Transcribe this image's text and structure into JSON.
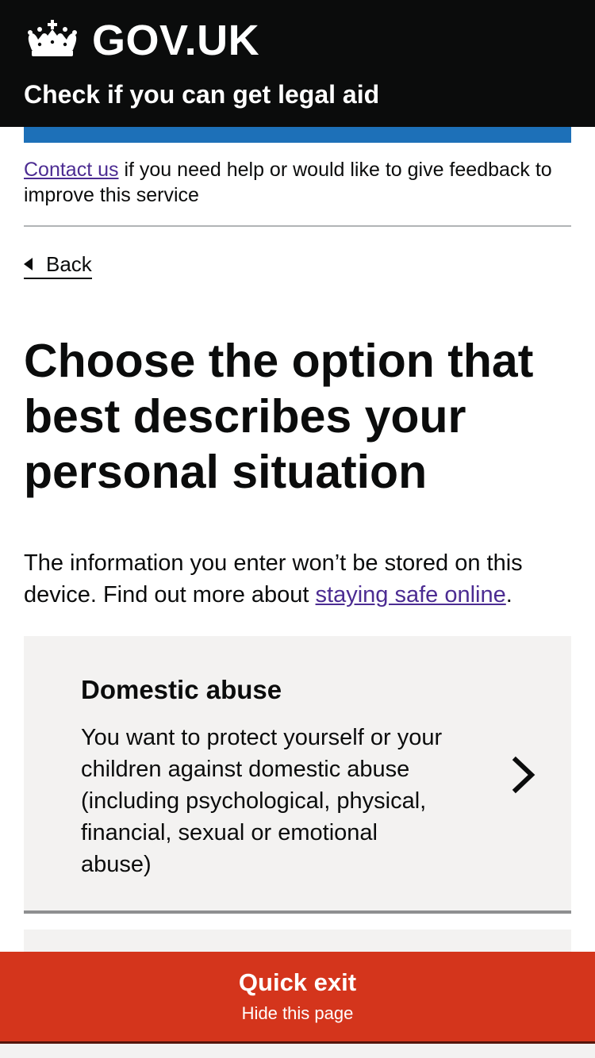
{
  "header": {
    "logotype": "GOV.UK",
    "service_name": "Check if you can get legal aid",
    "crown_icon": "crown-icon"
  },
  "banner": {
    "link": "Contact us",
    "text": " if you need help or would like to give feedback to improve this service"
  },
  "back_link": {
    "label": "Back"
  },
  "page": {
    "heading": "Choose the option that best describes your personal situation",
    "intro_before": "The information you enter won’t be stored on this device. Find out more about ",
    "intro_link": "staying safe online",
    "intro_after": "."
  },
  "options": [
    {
      "title": "Domestic abuse",
      "description": "You want to protect yourself or your children against domestic abuse (including psychological, physical, financial, sexual or emotional abuse)"
    }
  ],
  "quick_exit": {
    "title": "Quick exit",
    "subtitle": "Hide this page"
  },
  "colors": {
    "header_bg": "#0b0c0c",
    "brand_blue": "#1d70b8",
    "link": "#4c2c92",
    "card_bg": "#f3f2f1",
    "quick_exit_bg": "#d4351c"
  }
}
